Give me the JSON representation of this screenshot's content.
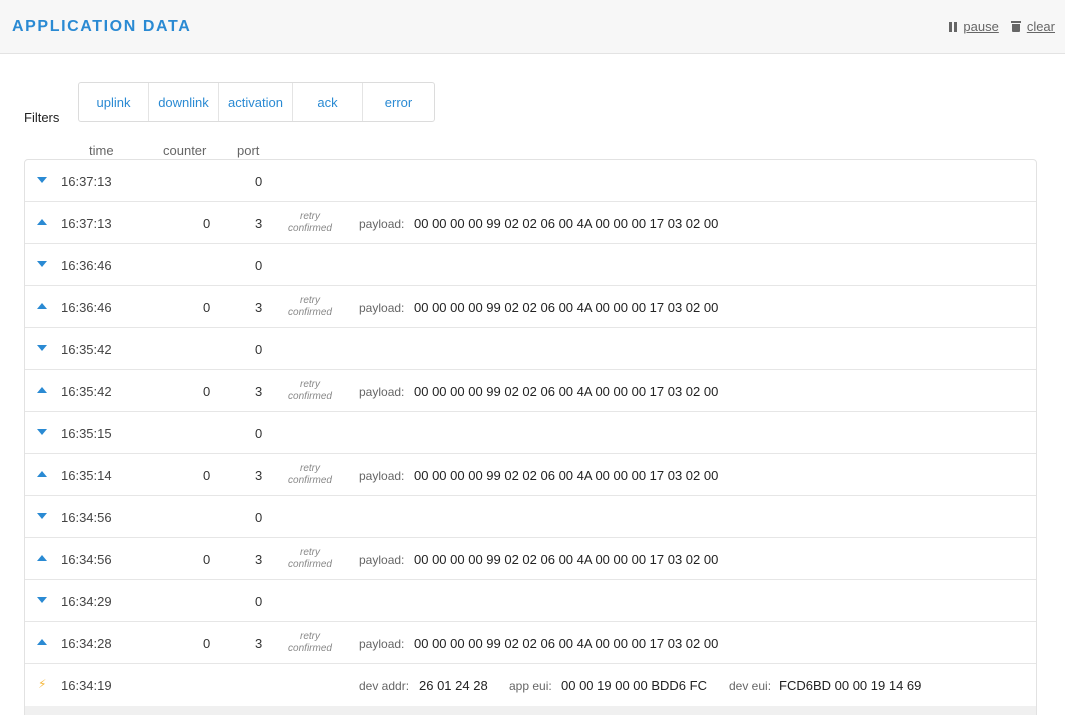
{
  "header": {
    "title": "APPLICATION DATA",
    "pause_label": "pause",
    "clear_label": "clear"
  },
  "filters": {
    "label": "Filters",
    "buttons": [
      "uplink",
      "downlink",
      "activation",
      "ack",
      "error"
    ]
  },
  "columns": {
    "time": "time",
    "counter": "counter",
    "port": "port"
  },
  "payload_label": "payload:",
  "retry_label": "retry",
  "confirmed_label": "confirmed",
  "rows": [
    {
      "dir": "down",
      "time": "16:37:13",
      "counter": "",
      "port": "0"
    },
    {
      "dir": "up",
      "time": "16:37:13",
      "counter": "0",
      "port": "3",
      "payload": "00 00 00 00 99 02 02 06 00 4A 00 00 00 17 03 02 00"
    },
    {
      "dir": "down",
      "time": "16:36:46",
      "counter": "",
      "port": "0"
    },
    {
      "dir": "up",
      "time": "16:36:46",
      "counter": "0",
      "port": "3",
      "payload": "00 00 00 00 99 02 02 06 00 4A 00 00 00 17 03 02 00"
    },
    {
      "dir": "down",
      "time": "16:35:42",
      "counter": "",
      "port": "0"
    },
    {
      "dir": "up",
      "time": "16:35:42",
      "counter": "0",
      "port": "3",
      "payload": "00 00 00 00 99 02 02 06 00 4A 00 00 00 17 03 02 00"
    },
    {
      "dir": "down",
      "time": "16:35:15",
      "counter": "",
      "port": "0"
    },
    {
      "dir": "up",
      "time": "16:35:14",
      "counter": "0",
      "port": "3",
      "payload": "00 00 00 00 99 02 02 06 00 4A 00 00 00 17 03 02 00"
    },
    {
      "dir": "down",
      "time": "16:34:56",
      "counter": "",
      "port": "0"
    },
    {
      "dir": "up",
      "time": "16:34:56",
      "counter": "0",
      "port": "3",
      "payload": "00 00 00 00 99 02 02 06 00 4A 00 00 00 17 03 02 00"
    },
    {
      "dir": "down",
      "time": "16:34:29",
      "counter": "",
      "port": "0"
    },
    {
      "dir": "up",
      "time": "16:34:28",
      "counter": "0",
      "port": "3",
      "payload": "00 00 00 00 99 02 02 06 00 4A 00 00 00 17 03 02 00"
    }
  ],
  "activation_row": {
    "time": "16:34:19",
    "dev_addr_label": "dev addr:",
    "dev_addr": "26 01 24 28",
    "app_eui_label": "app eui:",
    "app_eui": "00 00 19 00 00 BDD6 FC",
    "dev_eui_label": "dev eui:",
    "dev_eui": "FCD6BD 00 00 19 14 69"
  },
  "colors": {
    "accent": "#2a8ad3",
    "activation_icon": "#f5b83d"
  },
  "icons": {
    "pause": "pause-icon",
    "clear": "trash-icon",
    "uplink": "triangle-up-icon",
    "downlink": "triangle-down-icon",
    "activation": "lightning-bolt-icon"
  }
}
